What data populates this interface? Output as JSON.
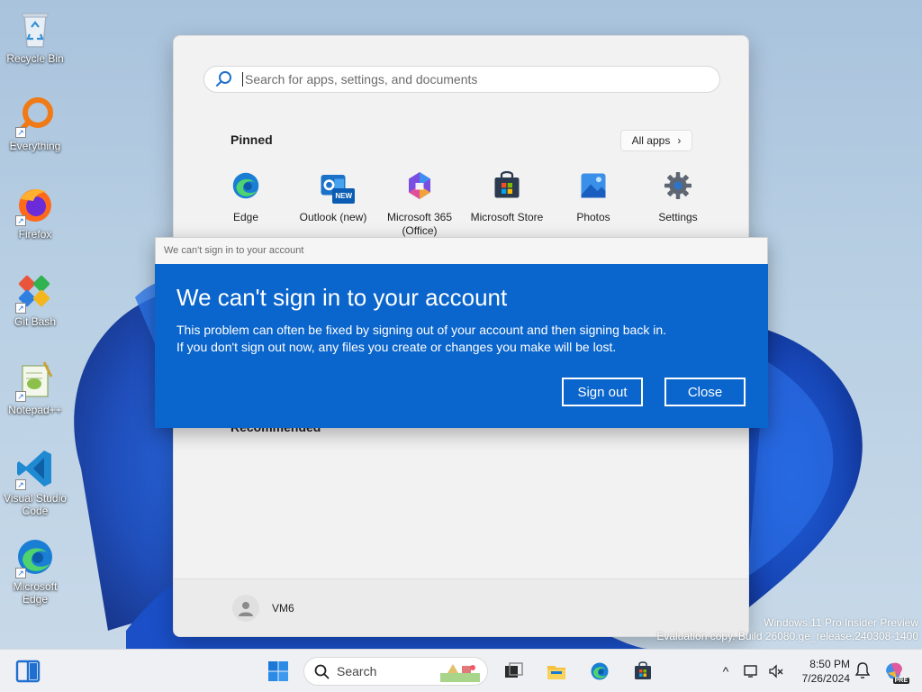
{
  "desktop": {
    "icons": [
      {
        "label": "Recycle Bin",
        "icon": "recycle-bin-icon"
      },
      {
        "label": "Everything",
        "icon": "everything-search-icon"
      },
      {
        "label": "Firefox",
        "icon": "firefox-icon"
      },
      {
        "label": "Git Bash",
        "icon": "git-bash-icon"
      },
      {
        "label": "Notepad++",
        "icon": "notepad-plus-plus-icon"
      },
      {
        "label": "Visual Studio Code",
        "icon": "vscode-icon"
      },
      {
        "label": "Microsoft Edge",
        "icon": "edge-icon"
      }
    ],
    "watermark_line1": "Windows 11 Pro Insider Preview",
    "watermark_line2": "Evaluation copy. Build 26080.ge_release.240308-1400"
  },
  "start_menu": {
    "search_placeholder": "Search for apps, settings, and documents",
    "pinned_title": "Pinned",
    "all_apps_label": "All apps",
    "pinned": [
      {
        "label": "Edge",
        "icon": "edge-icon"
      },
      {
        "label": "Outlook (new)",
        "icon": "outlook-icon"
      },
      {
        "label": "Microsoft 365 (Office)",
        "icon": "m365-icon"
      },
      {
        "label": "Microsoft Store",
        "icon": "store-icon"
      },
      {
        "label": "Photos",
        "icon": "photos-icon"
      },
      {
        "label": "Settings",
        "icon": "gear-icon"
      }
    ],
    "outlook_badge": "NEW",
    "recommended_title": "Recommended",
    "user_name": "VM6"
  },
  "dialog": {
    "window_title": "We can't sign in to your account",
    "heading": "We can't sign in to your account",
    "message_line1": "This problem can often be fixed by signing out of your account and then signing back in.",
    "message_line2": "If you don't sign out now, any files you create or changes you make will be lost.",
    "sign_out_label": "Sign out",
    "close_label": "Close",
    "accent_color": "#0a65cc"
  },
  "taskbar": {
    "search_label": "Search",
    "time": "8:50 PM",
    "date": "7/26/2024",
    "copilot_badge": "PRE"
  }
}
